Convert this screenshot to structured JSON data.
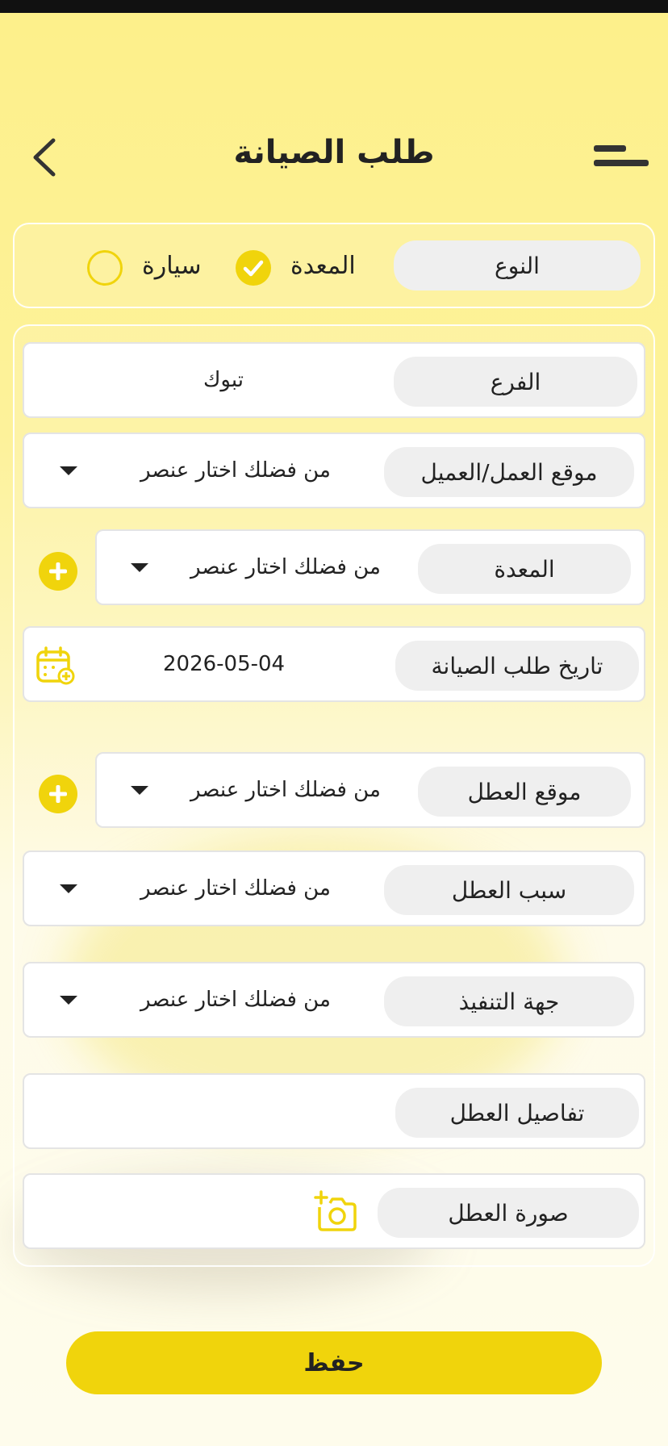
{
  "header": {
    "title": "طلب الصيانة"
  },
  "icons": {
    "back": "chevron-left-icon",
    "menu": "menu-icon",
    "add": "plus-circle-icon",
    "calendar": "calendar-add-icon",
    "camera": "camera-add-icon",
    "dropdown": "triangle-down-icon",
    "check": "check-icon"
  },
  "colors": {
    "accent": "#f0d40c",
    "background": "#fdf08a",
    "label_bg": "#efefef",
    "text": "#222222"
  },
  "type_selector": {
    "label": "النوع",
    "options": [
      {
        "label": "المعدة",
        "selected": true
      },
      {
        "label": "سيارة",
        "selected": false
      }
    ]
  },
  "form": {
    "branch": {
      "label": "الفرع",
      "value": "تبوك"
    },
    "work_site": {
      "label": "موقع العمل/العميل",
      "placeholder": "من فضلك اختار عنصر"
    },
    "equipment": {
      "label": "المعدة",
      "placeholder": "من فضلك اختار عنصر"
    },
    "request_date": {
      "label": "تاريخ طلب الصيانة",
      "value": "2026-05-04"
    },
    "fault_location": {
      "label": "موقع العطل",
      "placeholder": "من فضلك اختار عنصر"
    },
    "fault_reason": {
      "label": "سبب العطل",
      "placeholder": "من فضلك اختار عنصر"
    },
    "executing_party": {
      "label": "جهة التنفيذ",
      "placeholder": "من فضلك اختار عنصر"
    },
    "fault_details": {
      "label": "تفاصيل العطل",
      "value": ""
    },
    "fault_image": {
      "label": "صورة العطل"
    }
  },
  "actions": {
    "save_label": "حفظ"
  }
}
